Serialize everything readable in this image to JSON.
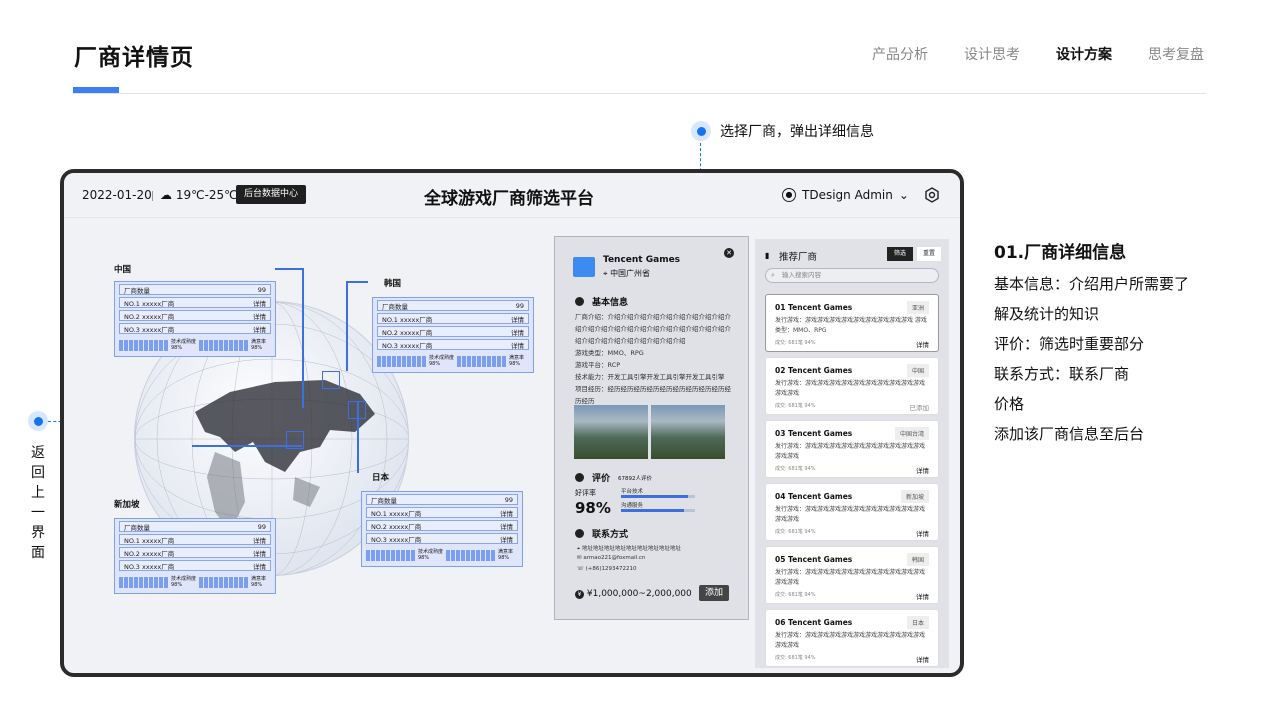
{
  "page": {
    "title": "厂商详情页",
    "nav": [
      "产品分析",
      "设计思考",
      "设计方案",
      "思考复盘"
    ],
    "active_nav": "设计方案",
    "annotation_top": "选择厂商，弹出详细信息",
    "annotation_back": "返回上一界面",
    "accent": "#1873f0"
  },
  "device": {
    "date": "2022-01-20",
    "weather": "19℃-25℃",
    "backend_btn": "后台数据中心",
    "title": "全球游戏厂商筛选平台",
    "user": "TDesign Admin",
    "map": {
      "regions": [
        {
          "label": "中国",
          "header": "厂商数量",
          "count": "99",
          "rows": [
            {
              "name": "NO.1  xxxxx厂商",
              "act": "详情"
            },
            {
              "name": "NO.2  xxxxx厂商",
              "act": "详情"
            },
            {
              "name": "NO.3  xxxxx厂商",
              "act": "详情"
            }
          ],
          "m1_label": "技术成熟度",
          "m1_val": "98%",
          "m2_label": "满意率",
          "m2_val": "98%"
        },
        {
          "label": "韩国",
          "header": "厂商数量",
          "count": "99",
          "rows": [
            {
              "name": "NO.1  xxxxx厂商",
              "act": "详情"
            },
            {
              "name": "NO.2  xxxxx厂商",
              "act": "详情"
            },
            {
              "name": "NO.3  xxxxx厂商",
              "act": "详情"
            }
          ],
          "m1_label": "技术成熟度",
          "m1_val": "98%",
          "m2_label": "满意率",
          "m2_val": "98%"
        },
        {
          "label": "日本",
          "header": "厂商数量",
          "count": "99",
          "rows": [
            {
              "name": "NO.1  xxxxx厂商",
              "act": "详情"
            },
            {
              "name": "NO.2  xxxxx厂商",
              "act": "详情"
            },
            {
              "name": "NO.3  xxxxx厂商",
              "act": "详情"
            }
          ],
          "m1_label": "技术成熟度",
          "m1_val": "98%",
          "m2_label": "满意率",
          "m2_val": "98%"
        },
        {
          "label": "新加坡",
          "header": "厂商数量",
          "count": "99",
          "rows": [
            {
              "name": "NO.1  xxxxx厂商",
              "act": "详情"
            },
            {
              "name": "NO.2  xxxxx厂商",
              "act": "详情"
            },
            {
              "name": "NO.3  xxxxx厂商",
              "act": "详情"
            }
          ],
          "m1_label": "技术成熟度",
          "m1_val": "98%",
          "m2_label": "满意率",
          "m2_val": "98%"
        }
      ]
    },
    "detail": {
      "name": "Tencent Games",
      "location": "中国广州省",
      "basic_title": "基本信息",
      "intro": "厂商介绍：介绍介绍介绍介绍介绍介绍介绍介绍介绍介绍介绍介绍介绍介绍介绍介绍介绍介绍介绍介绍介绍介绍介绍介绍介绍介绍介绍介绍介绍介绍",
      "game_type": "游戏类型：MMO、RPG",
      "platform": "游戏平台：RCP",
      "tech": "技术能力：开发工具引擎开发工具引擎开发工具引擎",
      "experience": "项目经历：经历经历经历经历经历经历经历经历经历经历经历",
      "rating_title": "评价",
      "rating_count": "67892人评价",
      "good_rate_label": "好评率",
      "good_rate": "98%",
      "metrics": [
        {
          "label": "平台技术",
          "value": 0.9
        },
        {
          "label": "沟通服务",
          "value": 0.85
        }
      ],
      "contact_title": "联系方式",
      "address": "地址地址地址地址地址地址地址地址地址",
      "email": "armao221@foxmail.cn",
      "phone": "(+86)1293472210",
      "price": "¥1,000,000~2,000,000",
      "add_btn": "添加"
    },
    "recommend": {
      "title": "推荐厂商",
      "filter_btn": "筛选",
      "reset_btn": "重置",
      "search_placeholder": "输入搜索内容",
      "items": [
        {
          "name": "01 Tencent Games",
          "tag": "亚洲",
          "desc": "发行游戏：游戏游戏游戏游戏游戏游戏游戏游戏游戏 游戏类型：MMO、RPG",
          "meta": "成交: 681笔  94%",
          "action": "详情"
        },
        {
          "name": "02 Tencent Games",
          "tag": "中国",
          "desc": "发行游戏：游戏游戏游戏游戏游戏游戏游戏游戏游戏游戏游戏游戏",
          "meta": "成交: 681笔  94%",
          "action": "已添加"
        },
        {
          "name": "03 Tencent Games",
          "tag": "中国台湾",
          "desc": "发行游戏：游戏游戏游戏游戏游戏游戏游戏游戏游戏游戏游戏游戏",
          "meta": "成交: 681笔  94%",
          "action": "详情"
        },
        {
          "name": "04 Tencent Games",
          "tag": "新加坡",
          "desc": "发行游戏：游戏游戏游戏游戏游戏游戏游戏游戏游戏游戏游戏游戏",
          "meta": "成交: 681笔  94%",
          "action": "详情"
        },
        {
          "name": "05 Tencent Games",
          "tag": "韩国",
          "desc": "发行游戏：游戏游戏游戏游戏游戏游戏游戏游戏游戏游戏游戏游戏",
          "meta": "成交: 681笔  94%",
          "action": "详情"
        },
        {
          "name": "06 Tencent Games",
          "tag": "日本",
          "desc": "发行游戏：游戏游戏游戏游戏游戏游戏游戏游戏游戏游戏游戏游戏",
          "meta": "成交: 681笔  94%",
          "action": "详情"
        }
      ]
    }
  },
  "explain": {
    "heading": "01.厂商详细信息",
    "lines": [
      "基本信息：介绍用户所需要了",
      "解及统计的知识",
      "评价：筛选时重要部分",
      "联系方式：联系厂商",
      "价格",
      "添加该厂商信息至后台"
    ]
  }
}
